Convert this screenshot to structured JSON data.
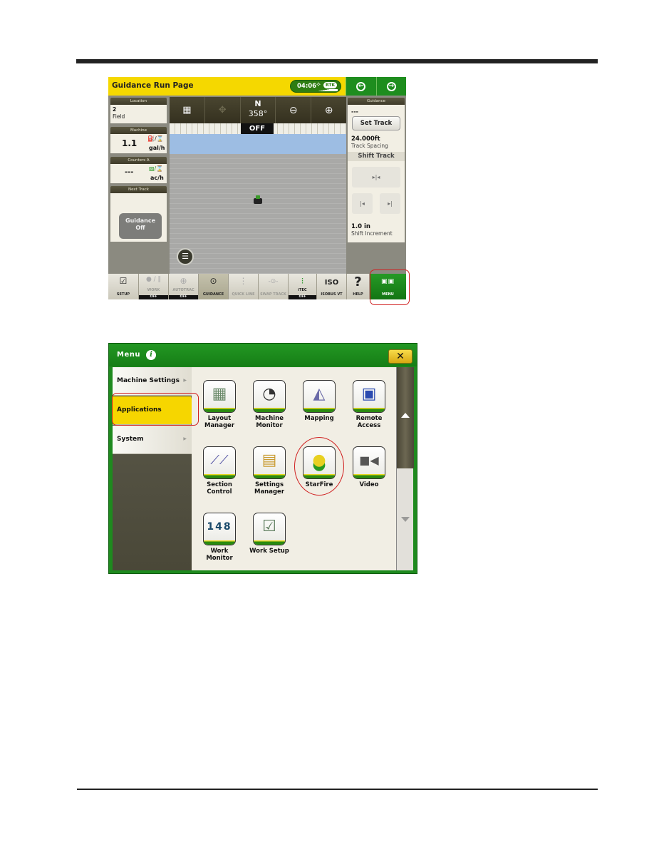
{
  "guidance_screen": {
    "header": {
      "title": "Guidance Run Page",
      "status_time": "04:06",
      "status_signal_icon": "satellite-icon",
      "status_badge": "RTK",
      "nav_back_icon": "arrow-left-circle-icon",
      "nav_forward_icon": "arrow-right-circle-icon"
    },
    "left_panels": {
      "location": {
        "header": "Location",
        "number": "2",
        "name": "Field"
      },
      "machine": {
        "header": "Machine",
        "value": "1.1",
        "unit": "gal/h",
        "icon": "fuel-per-hour-icon"
      },
      "counters": {
        "header": "Counters A",
        "value": "---",
        "unit": "ac/h",
        "icon": "area-per-hour-icon"
      },
      "next_track": {
        "header": "Next Track",
        "button_line1": "Guidance",
        "button_line2": "Off"
      }
    },
    "map": {
      "toolbar": [
        {
          "name": "map-view",
          "icon": "field-view-icon"
        },
        {
          "name": "pan",
          "icon": "pan-arrows-icon"
        },
        {
          "name": "compass",
          "heading": "N",
          "degrees": "358°"
        },
        {
          "name": "zoom-out",
          "icon": "zoom-out-icon"
        },
        {
          "name": "zoom-in",
          "icon": "zoom-in-icon"
        }
      ],
      "guidance_state": "OFF",
      "list_button_icon": "list-icon"
    },
    "right_panel": {
      "header": "Guidance",
      "track_name": "---",
      "set_track_label": "Set Track",
      "track_spacing_value": "24.000ft",
      "track_spacing_label": "Track Spacing",
      "shift_track_header": "Shift Track",
      "shift_center_glyph": "▸|◂",
      "shift_left_glyph": "|◂",
      "shift_right_glyph": "▸|",
      "shift_increment_value": "1.0 in",
      "shift_increment_label": "Shift Increment"
    },
    "bottom_bar": [
      {
        "label": "SETUP",
        "glyph": "☑",
        "state": ""
      },
      {
        "label": "WORK",
        "glyph": "● / ‖",
        "state": "OFF"
      },
      {
        "label": "AUTOTRAC",
        "glyph": "⊕",
        "state": "OFF"
      },
      {
        "label": "GUIDANCE",
        "glyph": "⊙",
        "state": ""
      },
      {
        "label": "QUICK LINE",
        "glyph": "⋮",
        "state": ""
      },
      {
        "label": "SWAP TRACK",
        "glyph": "-⊙-",
        "state": ""
      },
      {
        "label": "iTEC",
        "glyph": "⁝",
        "state": "OFF"
      },
      {
        "label": "ISOBUS VT",
        "glyph": "ISO",
        "state": ""
      },
      {
        "label": "HELP",
        "glyph": "?",
        "state": ""
      },
      {
        "label": "MENU",
        "glyph": "▣▣",
        "state": ""
      }
    ]
  },
  "menu_screen": {
    "header": {
      "title": "Menu",
      "info_glyph": "i",
      "close_glyph": "✕"
    },
    "sidebar": [
      {
        "label": "Machine Settings",
        "arrow": "▶",
        "selected": false
      },
      {
        "label": "Applications",
        "arrow": "",
        "selected": true
      },
      {
        "label": "System",
        "arrow": "▶",
        "selected": false
      }
    ],
    "apps": [
      {
        "line1": "Layout",
        "line2": "Manager",
        "icon": "layout-manager-icon",
        "glyph": "▦"
      },
      {
        "line1": "Machine",
        "line2": "Monitor",
        "icon": "gauge-icon",
        "glyph": "◔"
      },
      {
        "line1": "Mapping",
        "line2": "",
        "icon": "mapping-icon",
        "glyph": "◭"
      },
      {
        "line1": "Remote",
        "line2": "Access",
        "icon": "remote-access-icon",
        "glyph": "▣"
      },
      {
        "line1": "Section",
        "line2": "Control",
        "icon": "section-control-icon",
        "glyph": "⟋⟋"
      },
      {
        "line1": "Settings",
        "line2": "Manager",
        "icon": "settings-folder-icon",
        "glyph": "▤"
      },
      {
        "line1": "StarFire",
        "line2": "",
        "icon": "starfire-receiver-icon",
        "glyph": "●"
      },
      {
        "line1": "Video",
        "line2": "",
        "icon": "video-camera-icon",
        "glyph": "■◀"
      },
      {
        "line1": "Work",
        "line2": "Monitor",
        "icon": "counter-icon",
        "glyph": "148"
      },
      {
        "line1": "Work Setup",
        "line2": "",
        "icon": "clipboard-icon",
        "glyph": "☑"
      }
    ]
  },
  "colors": {
    "jd_green": "#1e8a1e",
    "jd_yellow": "#f5d800",
    "callout_red": "#d02020"
  }
}
